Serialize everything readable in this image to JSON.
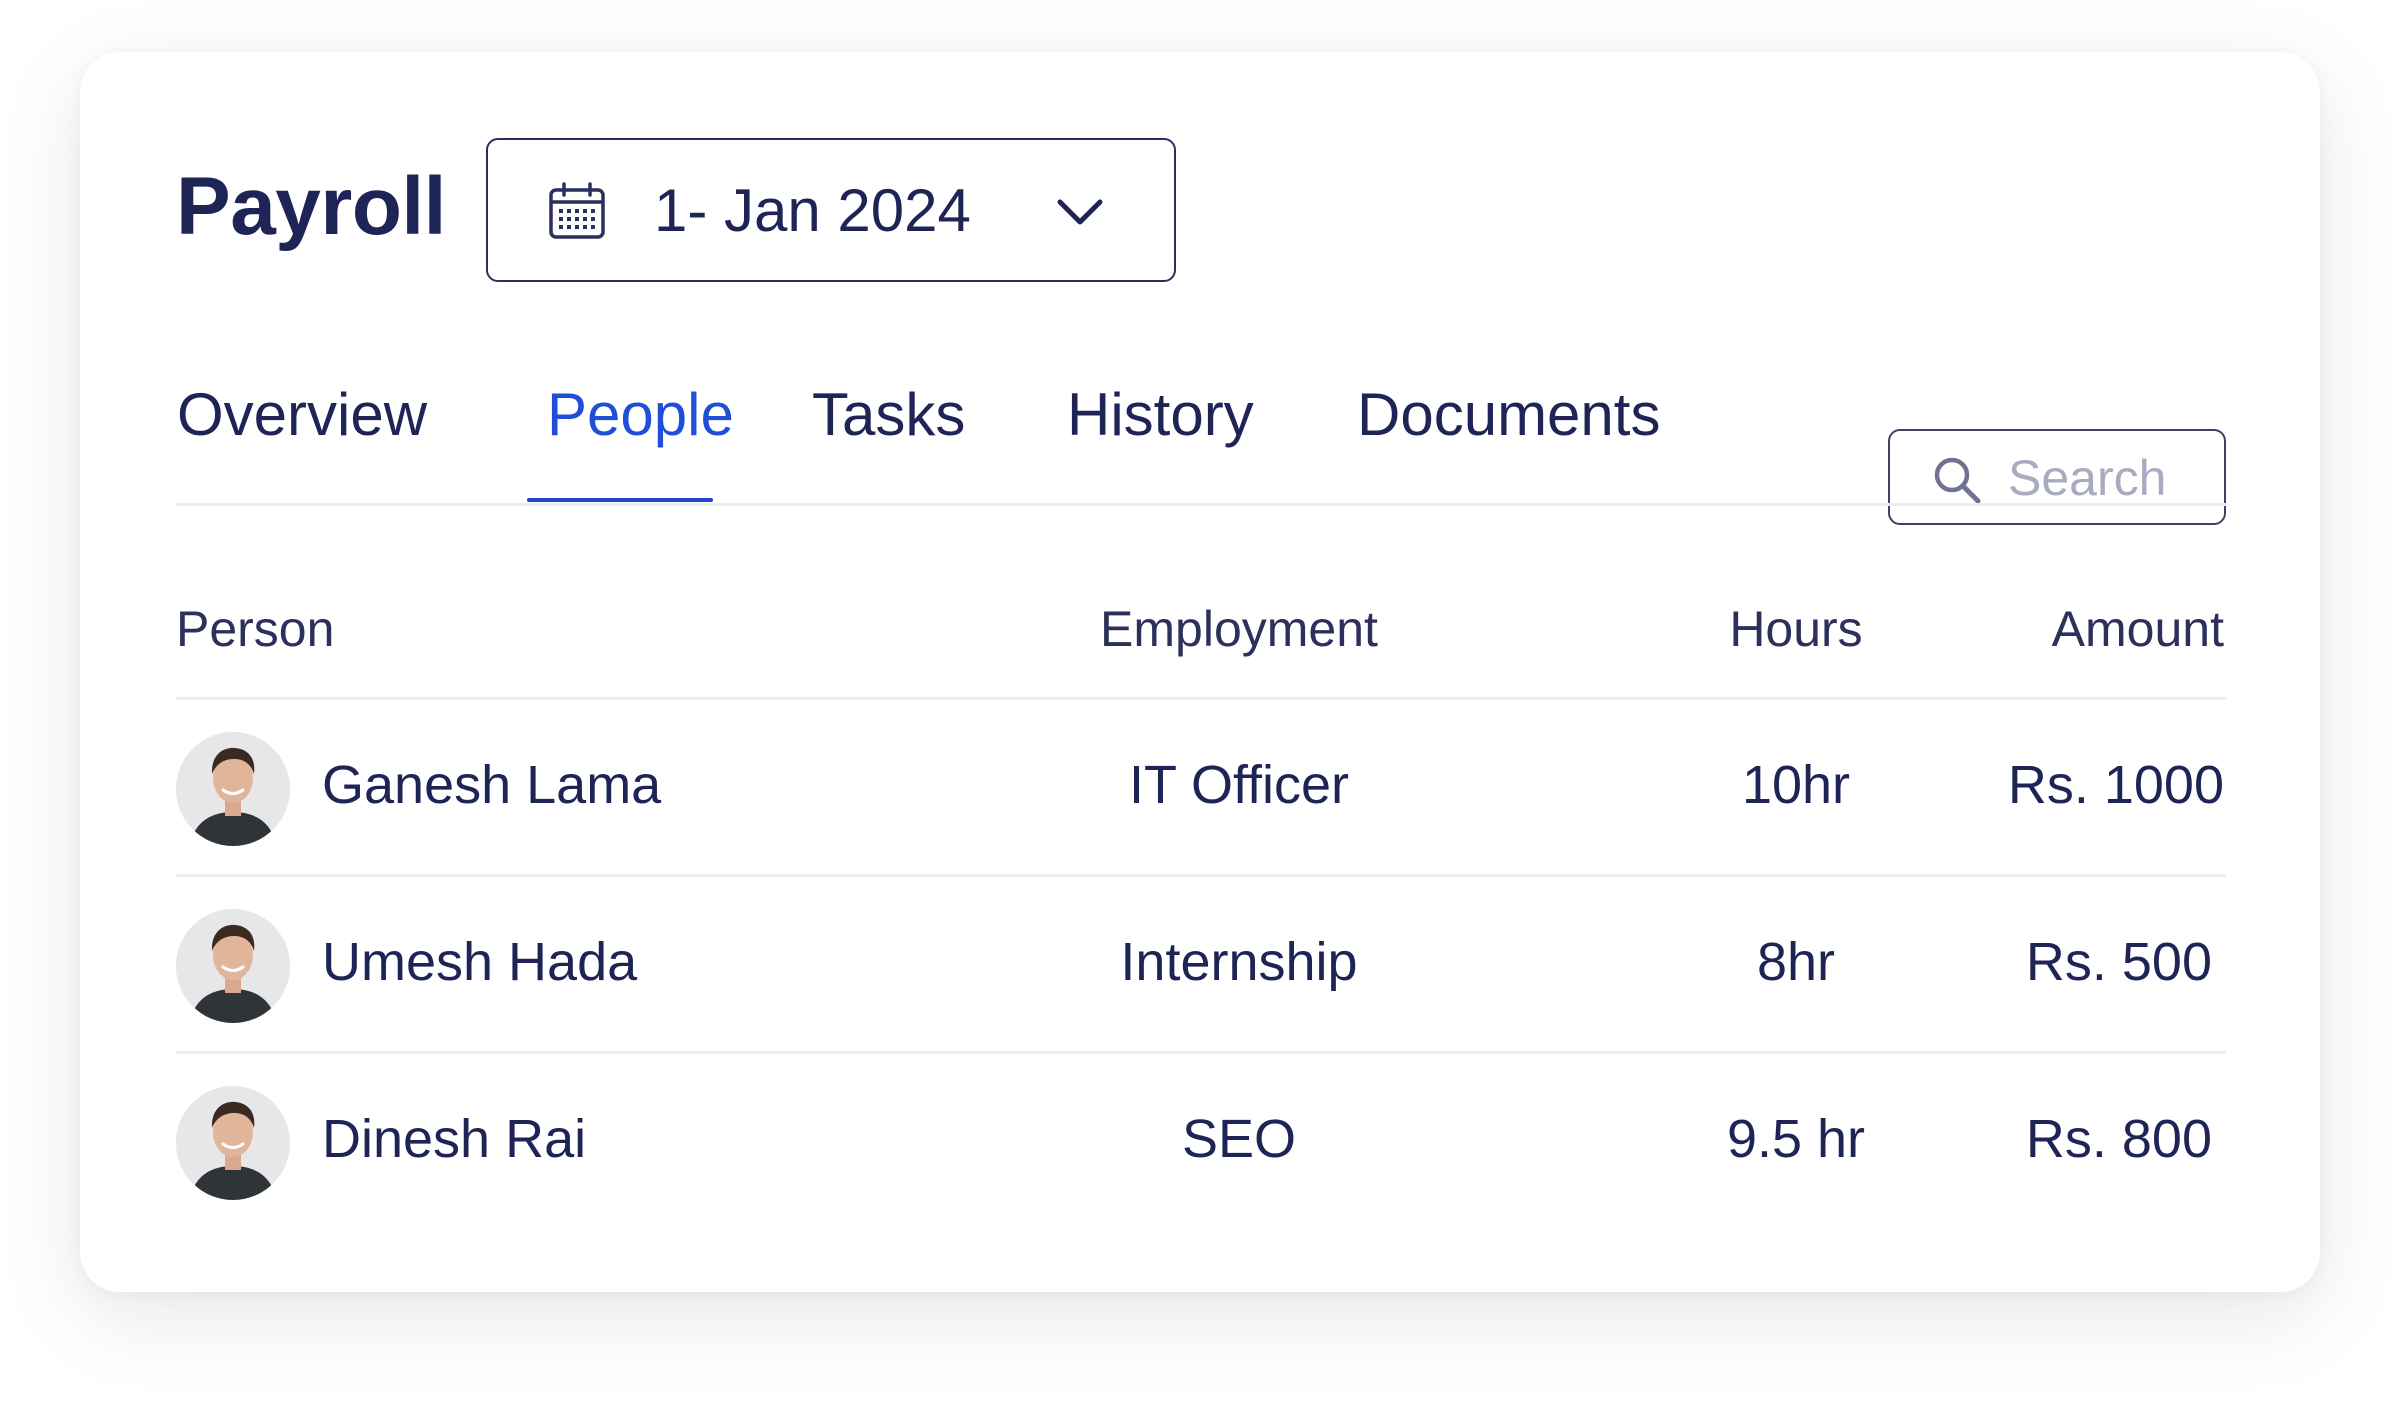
{
  "header": {
    "title": "Payroll",
    "date_picker": {
      "value": "1- Jan 2024",
      "icon": "calendar-icon",
      "dropdown_icon": "chevron-down-icon"
    }
  },
  "tabs": [
    {
      "label": "Overview",
      "active": false
    },
    {
      "label": "People",
      "active": true
    },
    {
      "label": "Tasks",
      "active": false
    },
    {
      "label": "History",
      "active": false
    },
    {
      "label": "Documents",
      "active": false
    }
  ],
  "search": {
    "placeholder": "Search",
    "value": "",
    "icon": "search-icon"
  },
  "table": {
    "columns": [
      "Person",
      "Employment",
      "Hours",
      "Amount"
    ],
    "rows": [
      {
        "name": "Ganesh Lama",
        "employment": "IT Officer",
        "hours": "10hr",
        "amount": "Rs. 1000"
      },
      {
        "name": "Umesh Hada",
        "employment": "Internship",
        "hours": "8hr",
        "amount": "Rs. 500"
      },
      {
        "name": "Dinesh Rai",
        "employment": "SEO",
        "hours": "9.5 hr",
        "amount": "Rs. 800"
      }
    ]
  },
  "colors": {
    "text": "#1f2456",
    "accent": "#1f4fd6",
    "placeholder": "#a9acc0",
    "divider": "#eceef3"
  }
}
